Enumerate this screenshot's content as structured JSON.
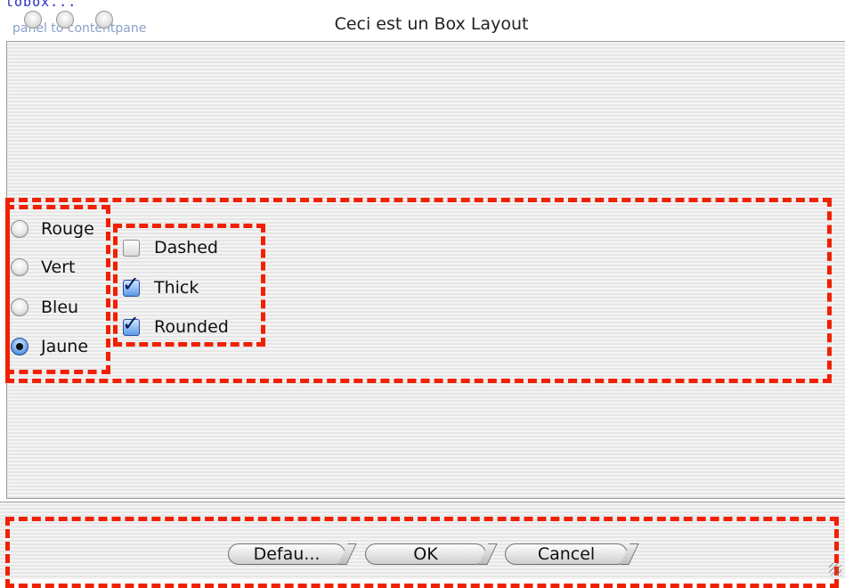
{
  "window": {
    "title": "Ceci est un Box Layout",
    "underlay_text": "panel to contentpane",
    "code_fragment": "tobox..."
  },
  "radio_group": {
    "items": [
      {
        "label": "Rouge",
        "selected": false
      },
      {
        "label": "Vert",
        "selected": false
      },
      {
        "label": "Bleu",
        "selected": false
      },
      {
        "label": "Jaune",
        "selected": true
      }
    ]
  },
  "checkbox_group": {
    "items": [
      {
        "label": "Dashed",
        "checked": false
      },
      {
        "label": "Thick",
        "checked": true
      },
      {
        "label": "Rounded",
        "checked": true
      }
    ]
  },
  "buttons": {
    "default_label": "Defau...",
    "ok_label": "OK",
    "cancel_label": "Cancel"
  },
  "colors": {
    "dashed_border": "#f02000",
    "selection_blue": "#5b9ae8"
  },
  "icons": [
    "close-icon",
    "minimize-icon",
    "zoom-icon",
    "checkmark-icon",
    "resize-grip-icon"
  ]
}
